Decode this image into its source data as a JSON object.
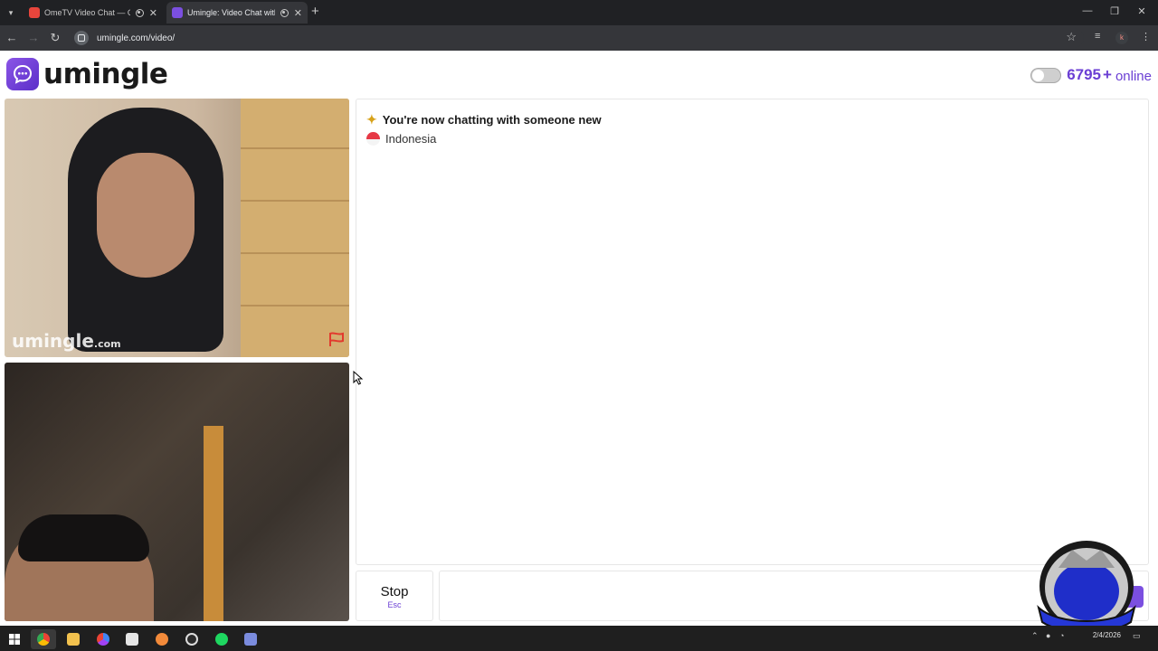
{
  "browser": {
    "tabs": [
      {
        "title": "OmeTV Video Chat — Ome",
        "active": false
      },
      {
        "title": "Umingle: Video Chat with S",
        "active": true
      }
    ],
    "url": "umingle.com/video/",
    "profile_initial": "k"
  },
  "header": {
    "logo_text": "umingle",
    "online_count": "6795",
    "online_plus": "+",
    "online_label": "online"
  },
  "videos": {
    "remote_watermark": "umingle",
    "remote_watermark_suffix": ".com"
  },
  "chat": {
    "status_message": "You're now chatting with someone new",
    "country": "Indonesia"
  },
  "controls": {
    "stop_label": "Stop",
    "stop_key": "Esc"
  },
  "taskbar": {
    "date": "2/4/2026"
  },
  "colors": {
    "brand": "#6b3fd4",
    "report_flag": "#e23a2e"
  }
}
